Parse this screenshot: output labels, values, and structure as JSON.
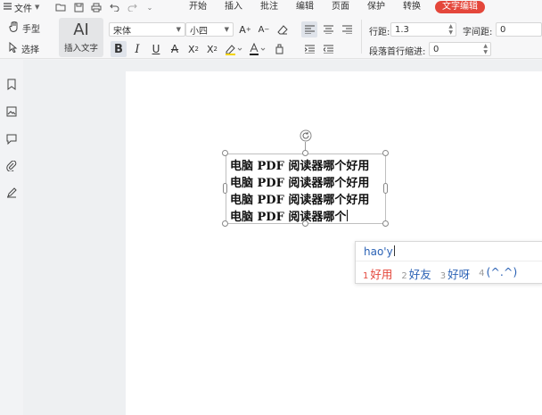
{
  "menubar": {
    "file_label": "文件",
    "tabs": [
      "开始",
      "插入",
      "批注",
      "编辑",
      "页面",
      "保护",
      "转换",
      "文字编辑"
    ],
    "active_tab": "文字编辑",
    "accent_color": "#e4473b"
  },
  "ribbon": {
    "hand_tool": "手型",
    "select_tool": "选择",
    "insert_text_glyph": "AI",
    "insert_text_label": "插入文字",
    "font_name": "宋体",
    "font_size": "小四",
    "line_spacing_label": "行距:",
    "line_spacing_value": "1.3",
    "char_spacing_label": "字间距:",
    "char_spacing_value": "0",
    "first_indent_label": "段落首行缩进:",
    "first_indent_value": "0"
  },
  "sidebar": {
    "icons": [
      "bookmark-icon",
      "thumbnail-icon",
      "comment-icon",
      "attachment-icon",
      "signature-icon"
    ]
  },
  "textbox": {
    "lines": [
      "电脑 PDF 阅读器哪个好用",
      "电脑 PDF 阅读器哪个好用",
      "电脑 PDF 阅读器哪个好用",
      "电脑 PDF 阅读器哪个"
    ]
  },
  "ime": {
    "pinyin": "hao'y",
    "candidates": [
      {
        "num": "1",
        "text": "好用"
      },
      {
        "num": "2",
        "text": "好友"
      },
      {
        "num": "3",
        "text": "好呀"
      },
      {
        "num": "4",
        "text": "(^.^)"
      }
    ]
  }
}
